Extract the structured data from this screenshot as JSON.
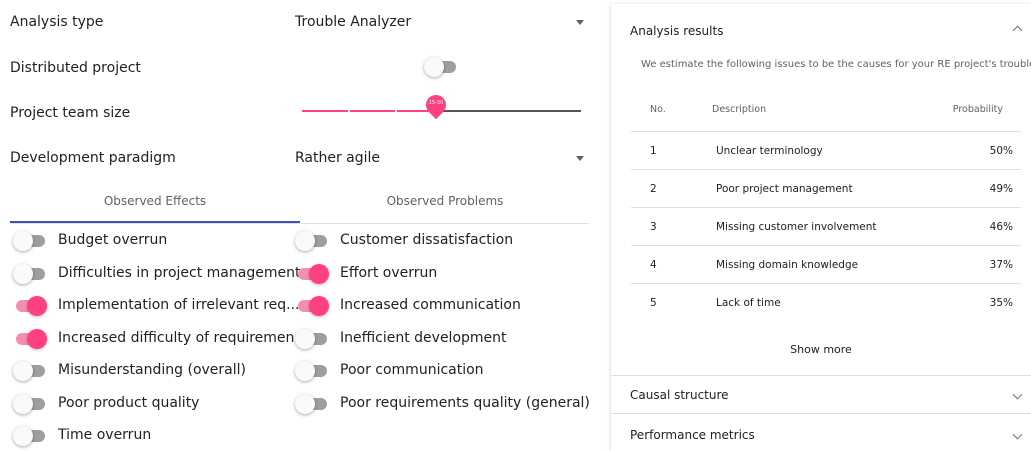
{
  "form": {
    "analysis_type_label": "Analysis type",
    "analysis_type_value": "Trouble Analyzer",
    "distributed_label": "Distributed project",
    "distributed_on": false,
    "team_size_label": "Project team size",
    "team_size_value": "15-30",
    "team_size_fraction": 0.46,
    "paradigm_label": "Development paradigm",
    "paradigm_value": "Rather agile"
  },
  "tabs": {
    "effects": "Observed Effects",
    "problems": "Observed Problems",
    "active": "effects"
  },
  "effects_left": [
    {
      "label": "Budget overrun",
      "on": false
    },
    {
      "label": "Difficulties in project management",
      "on": false
    },
    {
      "label": "Implementation of irrelevant req...",
      "on": true
    },
    {
      "label": "Increased difficulty of requiremen...",
      "on": true
    },
    {
      "label": "Misunderstanding (overall)",
      "on": false
    },
    {
      "label": "Poor product quality",
      "on": false
    },
    {
      "label": "Time overrun",
      "on": false
    }
  ],
  "effects_right": [
    {
      "label": "Customer dissatisfaction",
      "on": false
    },
    {
      "label": "Effort overrun",
      "on": true
    },
    {
      "label": "Increased communication",
      "on": true
    },
    {
      "label": "Inefficient development",
      "on": false
    },
    {
      "label": "Poor communication",
      "on": false
    },
    {
      "label": "Poor requirements quality (general)",
      "on": false
    }
  ],
  "results": {
    "title": "Analysis results",
    "intro": "We estimate the following issues to be the causes for your RE project's trouble.",
    "col_no": "No.",
    "col_desc": "Description",
    "col_prob": "Probability",
    "rows": [
      {
        "no": "1",
        "desc": "Unclear terminology",
        "prob": "50%"
      },
      {
        "no": "2",
        "desc": "Poor project management",
        "prob": "49%"
      },
      {
        "no": "3",
        "desc": "Missing customer involvement",
        "prob": "46%"
      },
      {
        "no": "4",
        "desc": "Missing domain knowledge",
        "prob": "37%"
      },
      {
        "no": "5",
        "desc": "Lack of time",
        "prob": "35%"
      }
    ],
    "show_more": "Show more"
  },
  "causal": {
    "title": "Causal structure"
  },
  "metrics": {
    "title": "Performance metrics"
  },
  "colors": {
    "accent": "#ff4081",
    "accent_light": "#f48fb1",
    "tab_indicator": "#3f51b5"
  }
}
